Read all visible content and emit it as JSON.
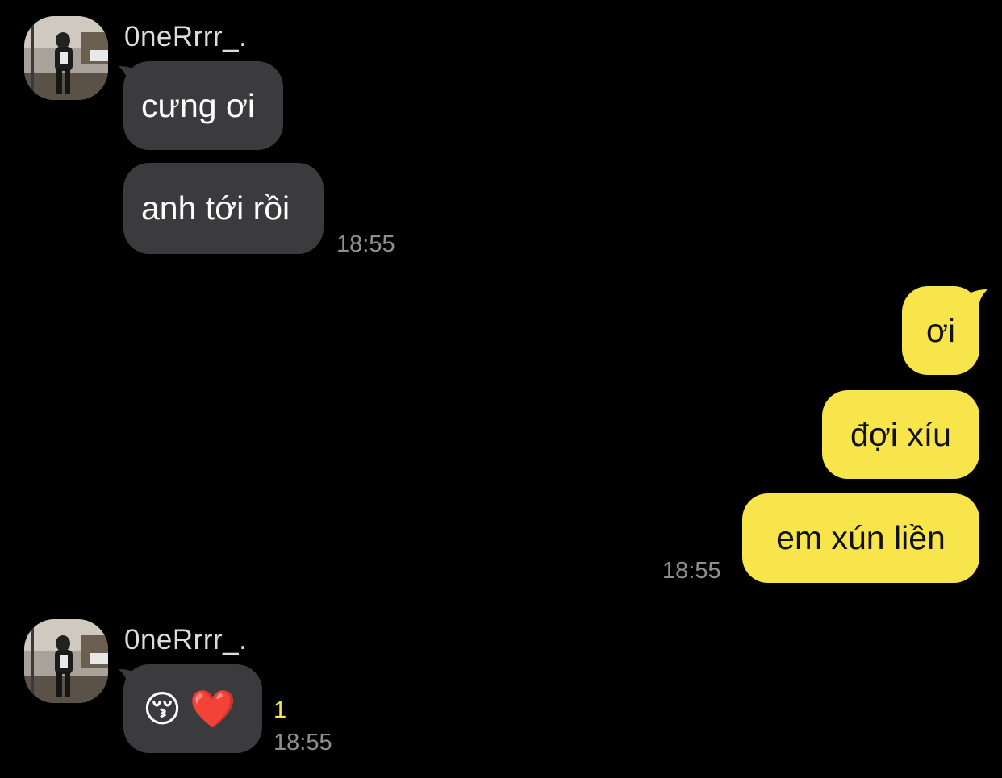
{
  "theme": {
    "background": "#000000",
    "incoming_bubble": "#3b3b3d",
    "outgoing_bubble": "#f8e54b",
    "timestamp_color": "#8f8f8f",
    "unread_color": "#f8e54b"
  },
  "conversation": {
    "group1": {
      "sender": "0neRrrr_.",
      "avatar_icon": "profile-photo",
      "messages": [
        "cưng ơi",
        "anh tới rồi"
      ],
      "time": "18:55"
    },
    "group2": {
      "messages": [
        "ơi",
        "đợi xíu",
        "em xún liền"
      ],
      "time": "18:55"
    },
    "group3": {
      "sender": "0neRrrr_.",
      "avatar_icon": "profile-photo",
      "emoji_message": "😚❤️",
      "unread_count": "1",
      "time": "18:55"
    }
  }
}
